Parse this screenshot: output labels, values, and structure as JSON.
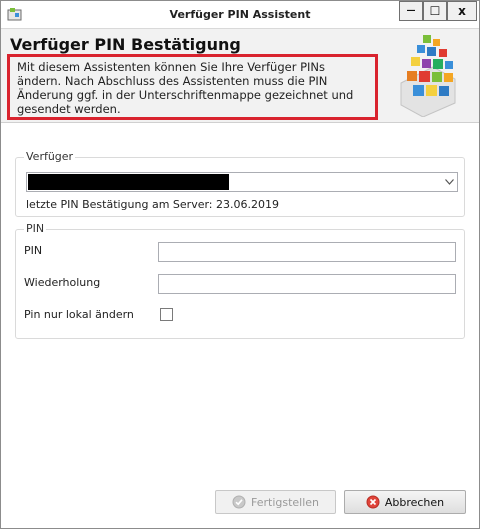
{
  "window": {
    "title": "Verfüger PIN Assistent",
    "minimize_glyph": "—",
    "maximize_glyph": "☐",
    "close_glyph": "x"
  },
  "header": {
    "title": "Verfüger PIN Bestätigung",
    "description": "Mit diesem Assistenten können Sie Ihre Verfüger PINs ändern. Nach Abschluss des Assistenten muss die PIN Änderung ggf. in der Unterschriftenmappe gezeichnet und gesendet werden.",
    "highlight_color": "#d9232e"
  },
  "verfueger_group": {
    "legend": "Verfüger",
    "selected_value": "",
    "last_confirmation": "letzte PIN Bestätigung am Server: 23.06.2019"
  },
  "pin_group": {
    "legend": "PIN",
    "pin_label": "PIN",
    "pin_value": "",
    "repeat_label": "Wiederholung",
    "repeat_value": "",
    "local_only_label": "Pin nur lokal ändern",
    "local_only_checked": false
  },
  "footer": {
    "finish_label": "Fertigstellen",
    "finish_enabled": false,
    "cancel_label": "Abbrechen"
  },
  "icons": {
    "app": "app-icon",
    "logo": "colored-blocks-logo",
    "finish": "check-circle-icon",
    "cancel": "red-x-circle-icon",
    "dropdown": "chevron-down-icon"
  }
}
